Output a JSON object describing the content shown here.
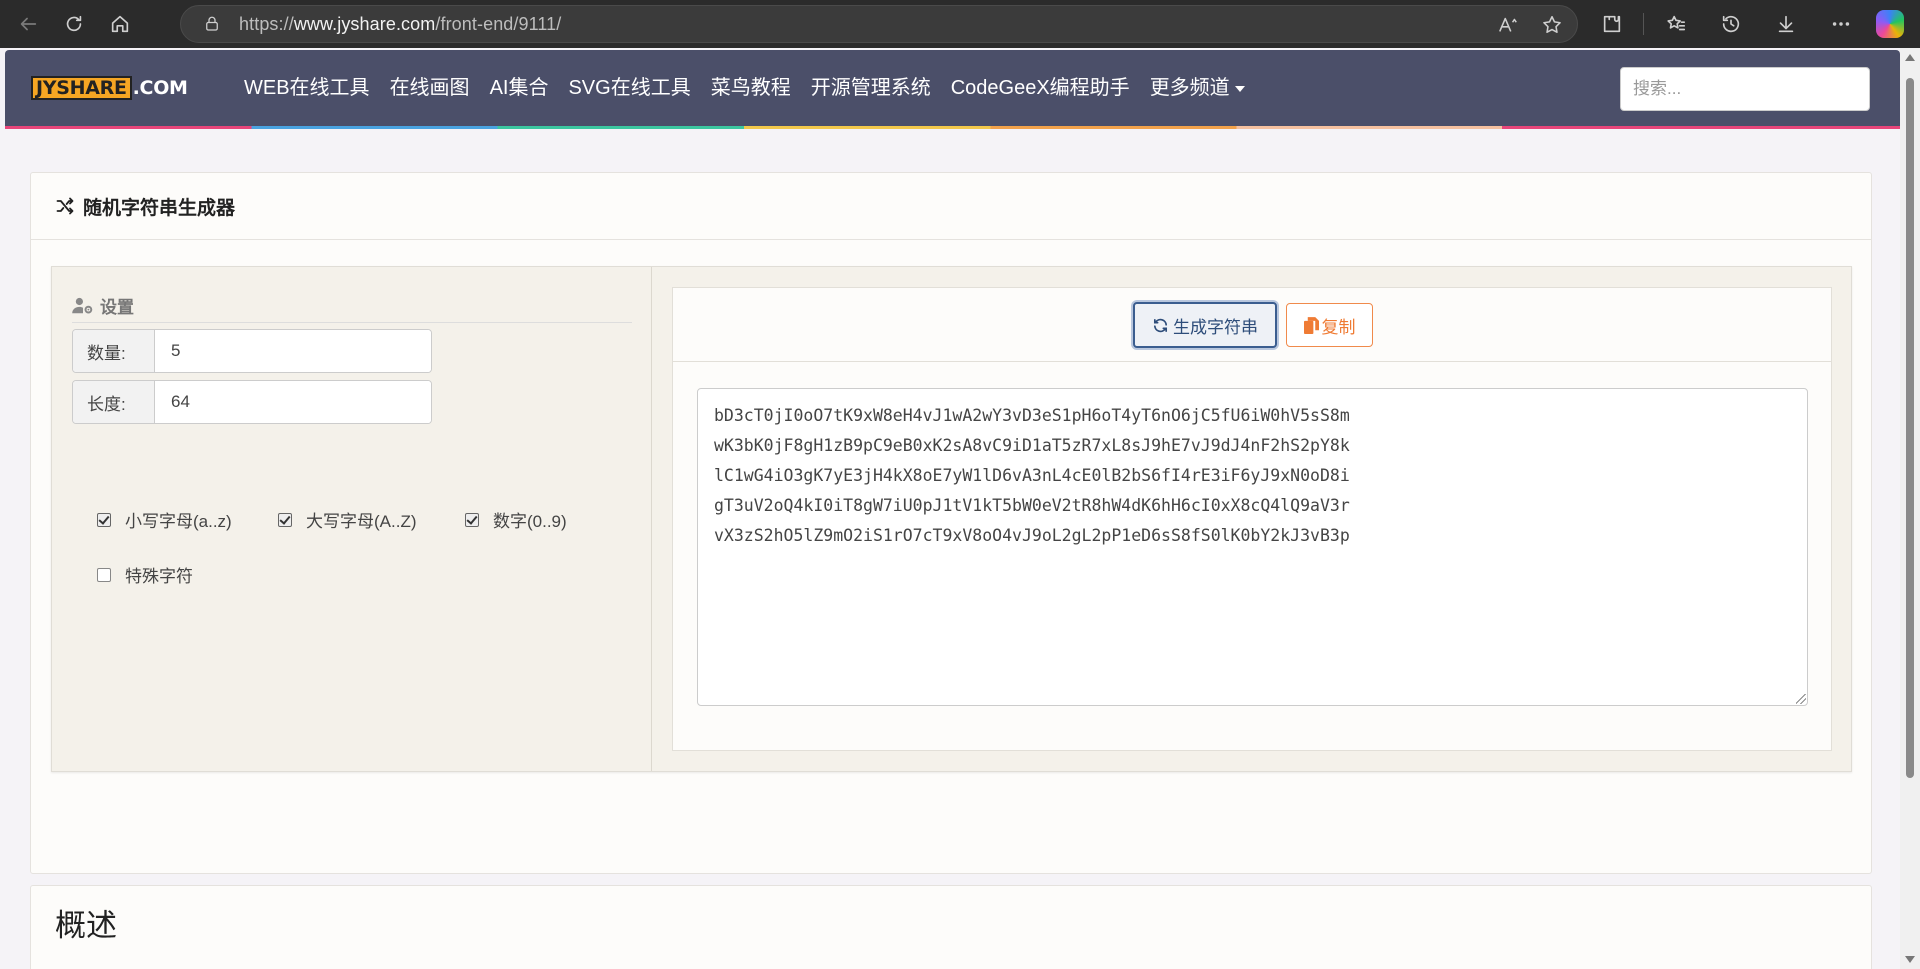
{
  "browser": {
    "url_prefix": "https://",
    "url_domain": "www.jyshare.com",
    "url_path": "/front-end/9111/"
  },
  "site": {
    "logo_main": "JYSHARE",
    "logo_suffix": ".COM",
    "menu": [
      "WEB在线工具",
      "在线画图",
      "AI集合",
      "SVG在线工具",
      "菜鸟教程",
      "开源管理系统",
      "CodeGeeX编程助手",
      "更多频道"
    ],
    "search_placeholder": "搜索..."
  },
  "tool": {
    "title": "随机字符串生成器",
    "settings_title": "设置",
    "count_label": "数量:",
    "count_value": "5",
    "length_label": "长度:",
    "length_value": "64",
    "options": [
      {
        "label": "小写字母(a..z)",
        "checked": true
      },
      {
        "label": "大写字母(A..Z)",
        "checked": true
      },
      {
        "label": "数字(0..9)",
        "checked": true
      },
      {
        "label": "特殊字符",
        "checked": false
      }
    ],
    "generate_label": "生成字符串",
    "copy_label": "复制",
    "output": "bD3cT0jI0oO7tK9xW8eH4vJ1wA2wY3vD3eS1pH6oT4yT6nO6jC5fU6iW0hV5sS8m\nwK3bK0jF8gH1zB9pC9eB0xK2sA8vC9iD1aT5zR7xL8sJ9hE7vJ9dJ4nF2hS2pY8k\nlC1wG4iO3gK7yE3jH4kX8oE7yW1lD6vA3nL4cE0lB2bS6fI4rE3iF6yJ9xN0oD8i\ngT3uV2oQ4kI0iT8gW7iU0pJ1tV1kT5bW0eV2tR8hW4dK6hH6cI0xX8cQ4lQ9aV3r\nvX3zS2hO5lZ9mO2iS1rO7cT9xV8oO4vJ9oL2gL2pP1eD6sS8fS0lK0bY2kJ3vB3p"
  },
  "overview": {
    "title": "概述"
  }
}
